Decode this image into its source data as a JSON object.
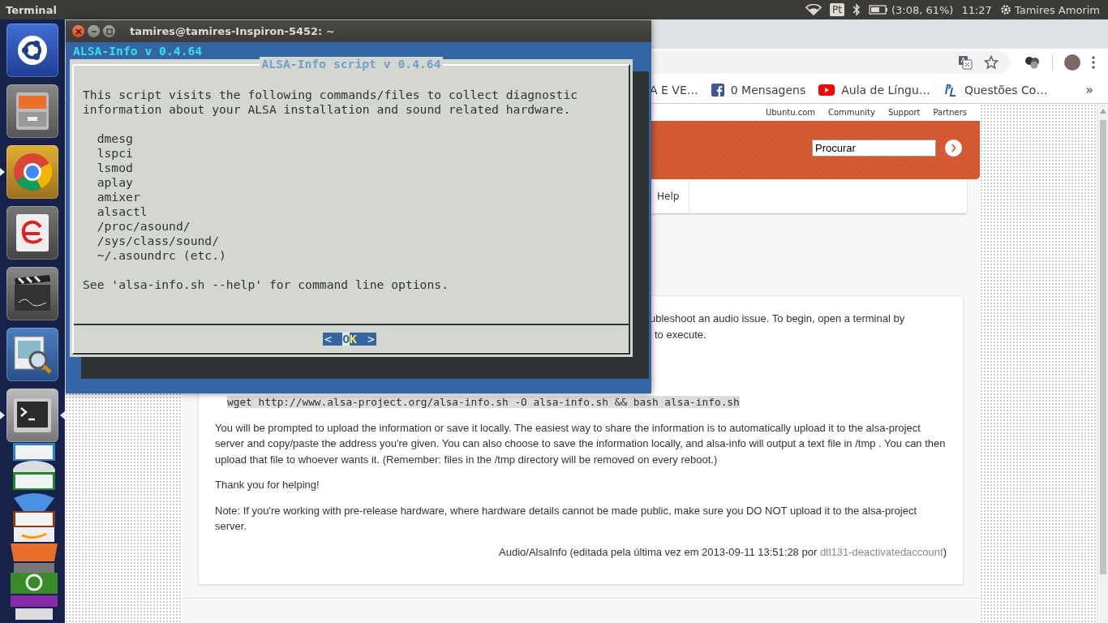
{
  "top_bar": {
    "app_name": "Terminal",
    "keyboard_layout": "Pt",
    "battery": "(3:08, 61%)",
    "clock": "11:27",
    "user": "Tamires Amorim"
  },
  "launcher": {
    "items": [
      {
        "kind": "dash",
        "running": false,
        "focused": false
      },
      {
        "kind": "files",
        "running": false,
        "focused": false
      },
      {
        "kind": "chrome",
        "running": true,
        "focused": false
      },
      {
        "kind": "ebook",
        "running": false,
        "focused": false
      },
      {
        "kind": "video",
        "running": false,
        "focused": false
      },
      {
        "kind": "viewer",
        "running": false,
        "focused": false
      },
      {
        "kind": "terminal",
        "running": true,
        "focused": true
      }
    ]
  },
  "browser": {
    "bookmarks": [
      {
        "kind": "plain",
        "label": "A E VE…"
      },
      {
        "kind": "facebook",
        "label": "0 Mensagens"
      },
      {
        "kind": "youtube",
        "label": "Aula de Língu…"
      },
      {
        "kind": "pl",
        "label": "Questões Co…"
      }
    ],
    "more": "»"
  },
  "page": {
    "top_links": [
      "Ubuntu.com",
      "Community",
      "Support",
      "Partners"
    ],
    "search": {
      "value": "Procurar"
    },
    "nav": [
      "Help"
    ],
    "article": {
      "intro_lines": [
        "ubleshoot an audio issue. To begin, open a terminal by",
        "to execute."
      ],
      "command": "wget http://www.alsa-project.org/alsa-info.sh -O alsa-info.sh && bash alsa-info.sh",
      "paragraphs": [
        "You will be prompted to upload the information or save it locally. The easiest way to share the information is to automatically upload it to the alsa-project server and copy/paste the address you're given. You can also choose to save the information locally, and alsa-info will output a text file in /tmp . You can then upload that file to whoever wants it. (Remember: files in the /tmp directory will be removed on every reboot.)",
        "Thank you for helping!",
        "Note: If you're working with pre-release hardware, where hardware details cannot be made public, make sure you DO NOT upload it to the alsa-project server."
      ],
      "footer": {
        "text": "Audio/AlsaInfo (editada pela última vez em 2013-09-11 13:51:28 por ",
        "author": "dtl131-deactivatedaccount",
        "close": ")"
      }
    }
  },
  "terminal": {
    "title": "tamires@tamires-Inspiron-5452: ~",
    "backtitle": "ALSA-Info v 0.4.64",
    "dialog": {
      "title": "ALSA-Info script v 0.4.64",
      "intro": "This script visits the following commands/files to collect diagnostic information about your ALSA installation and sound related hardware.",
      "items": [
        "dmesg",
        "lspci",
        "lsmod",
        "aplay",
        "amixer",
        "alsactl",
        "/proc/asound/",
        "/sys/class/sound/",
        "~/.asoundrc (etc.)"
      ],
      "footer": "See 'alsa-info.sh --help' for command line options.",
      "button": {
        "left": "<",
        "label": "OK",
        "right": ">"
      }
    }
  }
}
